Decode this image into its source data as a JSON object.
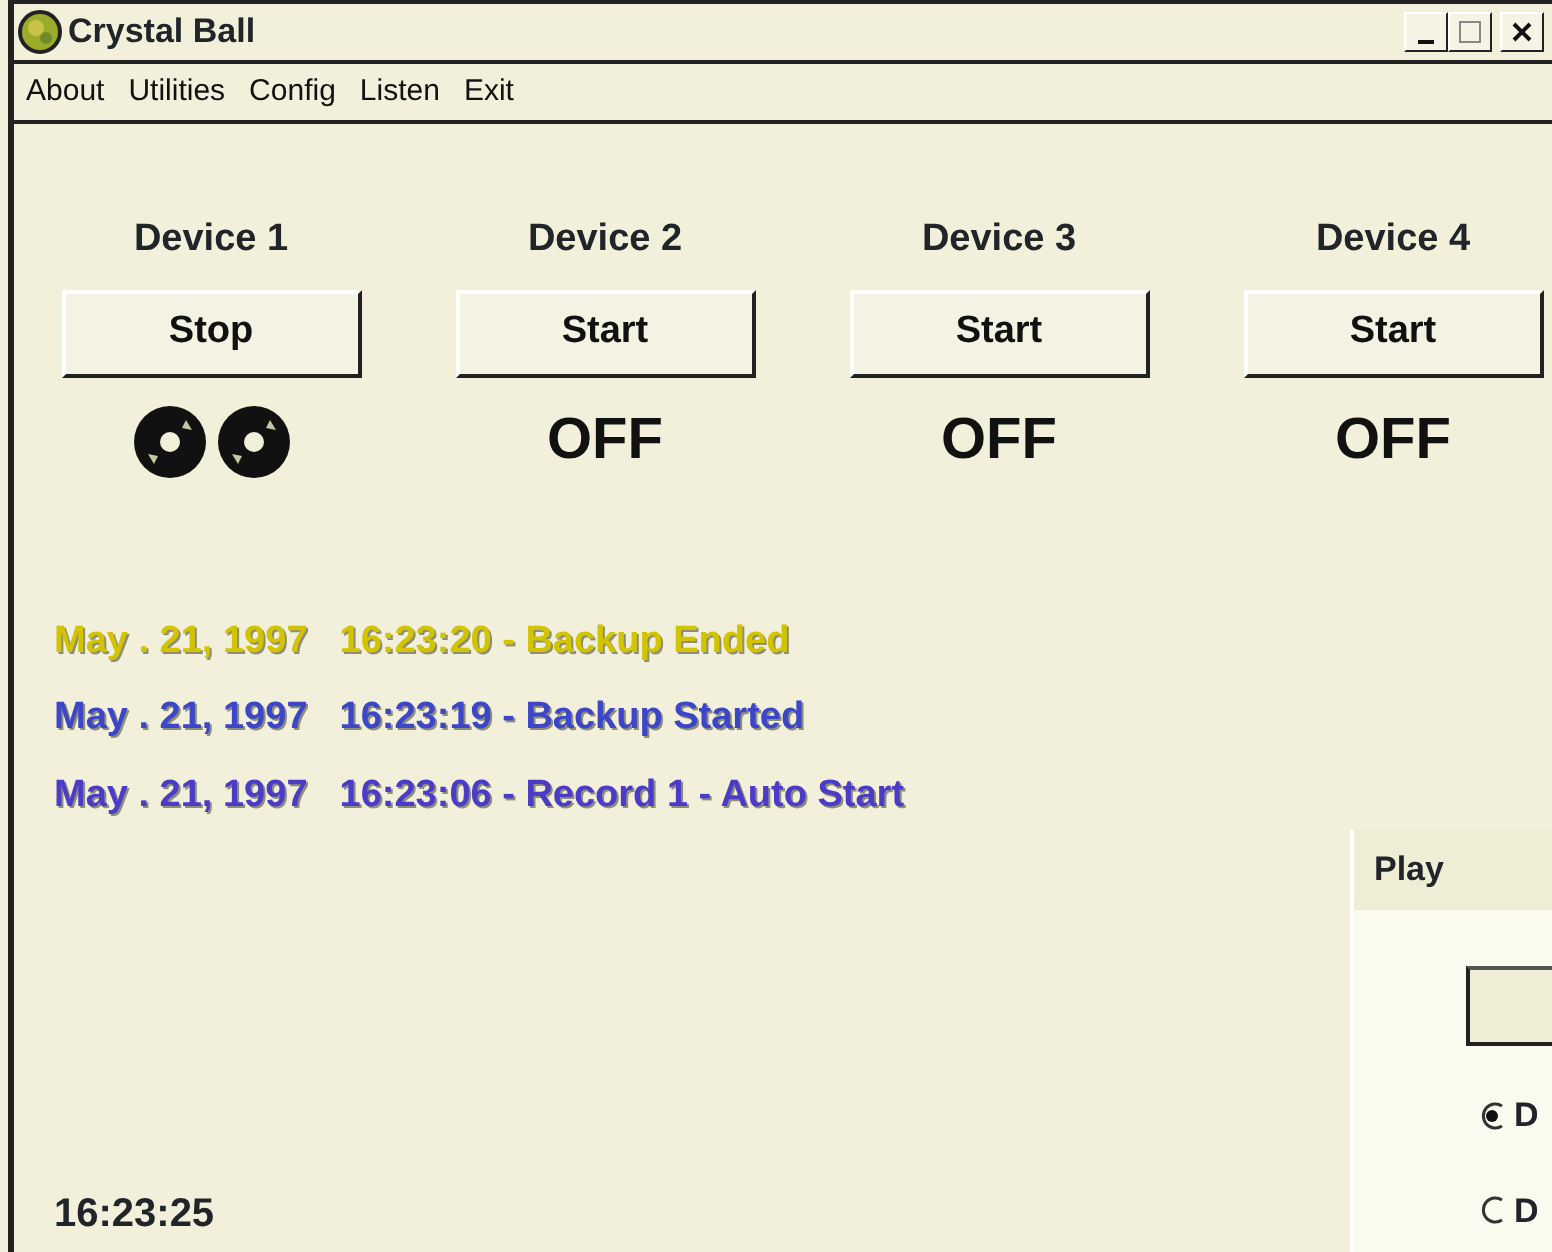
{
  "window": {
    "title": "Crystal Ball"
  },
  "menu": [
    {
      "label": "About"
    },
    {
      "label": "Utilities"
    },
    {
      "label": "Config"
    },
    {
      "label": "Listen"
    },
    {
      "label": "Exit"
    }
  ],
  "devices": [
    {
      "name": "Device 1",
      "button": "Stop",
      "status": {
        "kind": "reels"
      }
    },
    {
      "name": "Device 2",
      "button": "Start",
      "status": {
        "kind": "text",
        "text": "OFF"
      }
    },
    {
      "name": "Device 3",
      "button": "Start",
      "status": {
        "kind": "text",
        "text": "OFF"
      }
    },
    {
      "name": "Device 4",
      "button": "Start",
      "status": {
        "kind": "text",
        "text": "OFF"
      }
    }
  ],
  "log": [
    {
      "date": "May . 21, 1997",
      "message": "16:23:20 - Backup Ended",
      "color": "#d2c400"
    },
    {
      "date": "May . 21, 1997",
      "message": "16:23:19 - Backup Started",
      "color": "#3c46c8"
    },
    {
      "date": "May . 21, 1997",
      "message": "16:23:06 - Record 1 - Auto Start",
      "color": "#4a3cc8"
    }
  ],
  "clock": "16:23:25",
  "play_panel": {
    "title": "Play",
    "options": [
      {
        "label": "D",
        "selected": true
      },
      {
        "label": "D",
        "selected": false
      }
    ]
  }
}
